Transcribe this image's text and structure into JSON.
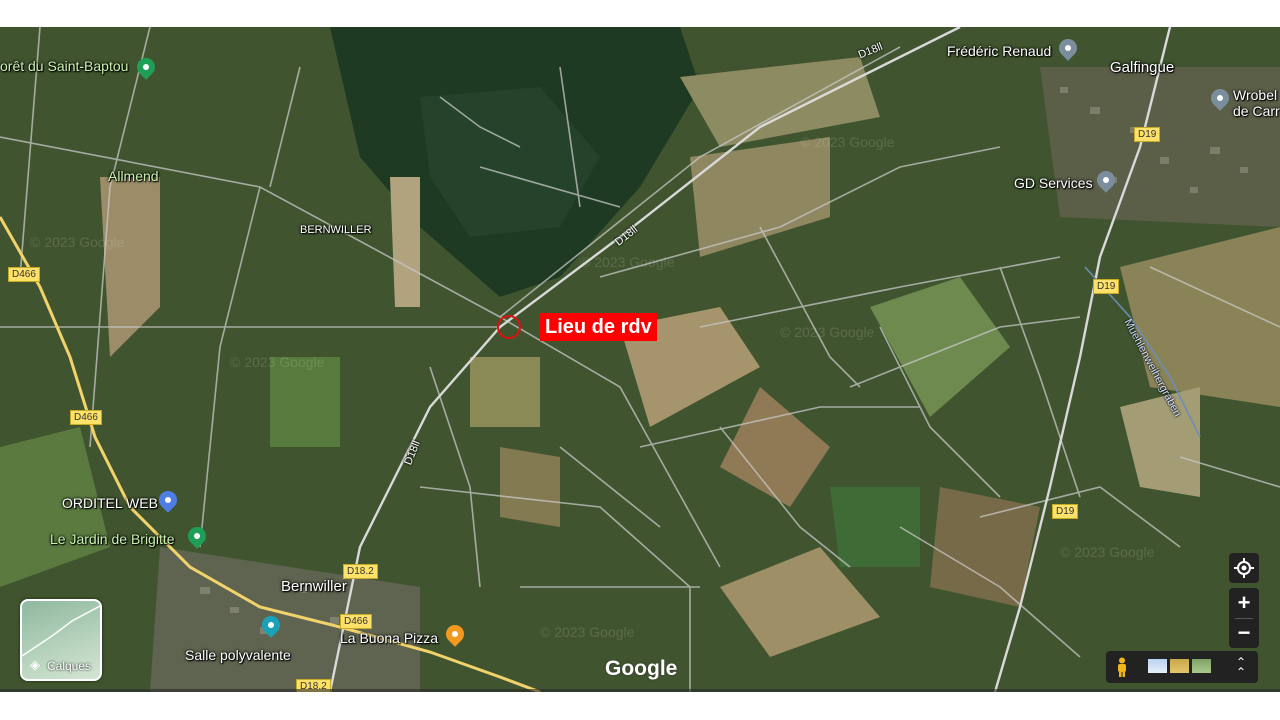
{
  "map": {
    "places": {
      "foret": "orêt du Saint-Baptou",
      "frederic": "Frédéric Renaud",
      "galfingue": "Galfingue",
      "wrobel_1": "Wrobel",
      "wrobel_2": "de Carr",
      "allmend": "Allmend",
      "bernwiller_caps": "BERNWILLER",
      "gd_services": "GD Services",
      "orditel": "ORDITEL WEB",
      "jardin": "Le Jardin de Brigitte",
      "bernwiller": "Bernwiller",
      "buona": "La Buona Pizza",
      "salle": "Salle polyvalente"
    },
    "roads": {
      "d466_a": "D466",
      "d466_b": "D466",
      "d466_c": "D466",
      "d19_a": "D19",
      "d19_b": "D19",
      "d19_c": "D19",
      "d182_a": "D18.2",
      "d182_b": "D18.2",
      "d18ll_a": "D18ll",
      "d18ll_b": "D18ll",
      "d18ll_c": "D18ll",
      "muehlen": "Muehlenweihergraben"
    },
    "marker": {
      "label": "Lieu de rdv",
      "color": "#ff0000"
    },
    "watermark": "© 2023 Google",
    "google_logo": "Google",
    "layers_label": "Calques"
  },
  "controls": {
    "zoom_in": "+",
    "zoom_out": "−",
    "expand": "⌃⌃"
  },
  "colors": {
    "road_yellow": "#f2d36b",
    "road_white": "#c9c9c9",
    "field_dark": "#3d5230",
    "forest": "#1f3a22",
    "marker_red": "#e01010"
  }
}
